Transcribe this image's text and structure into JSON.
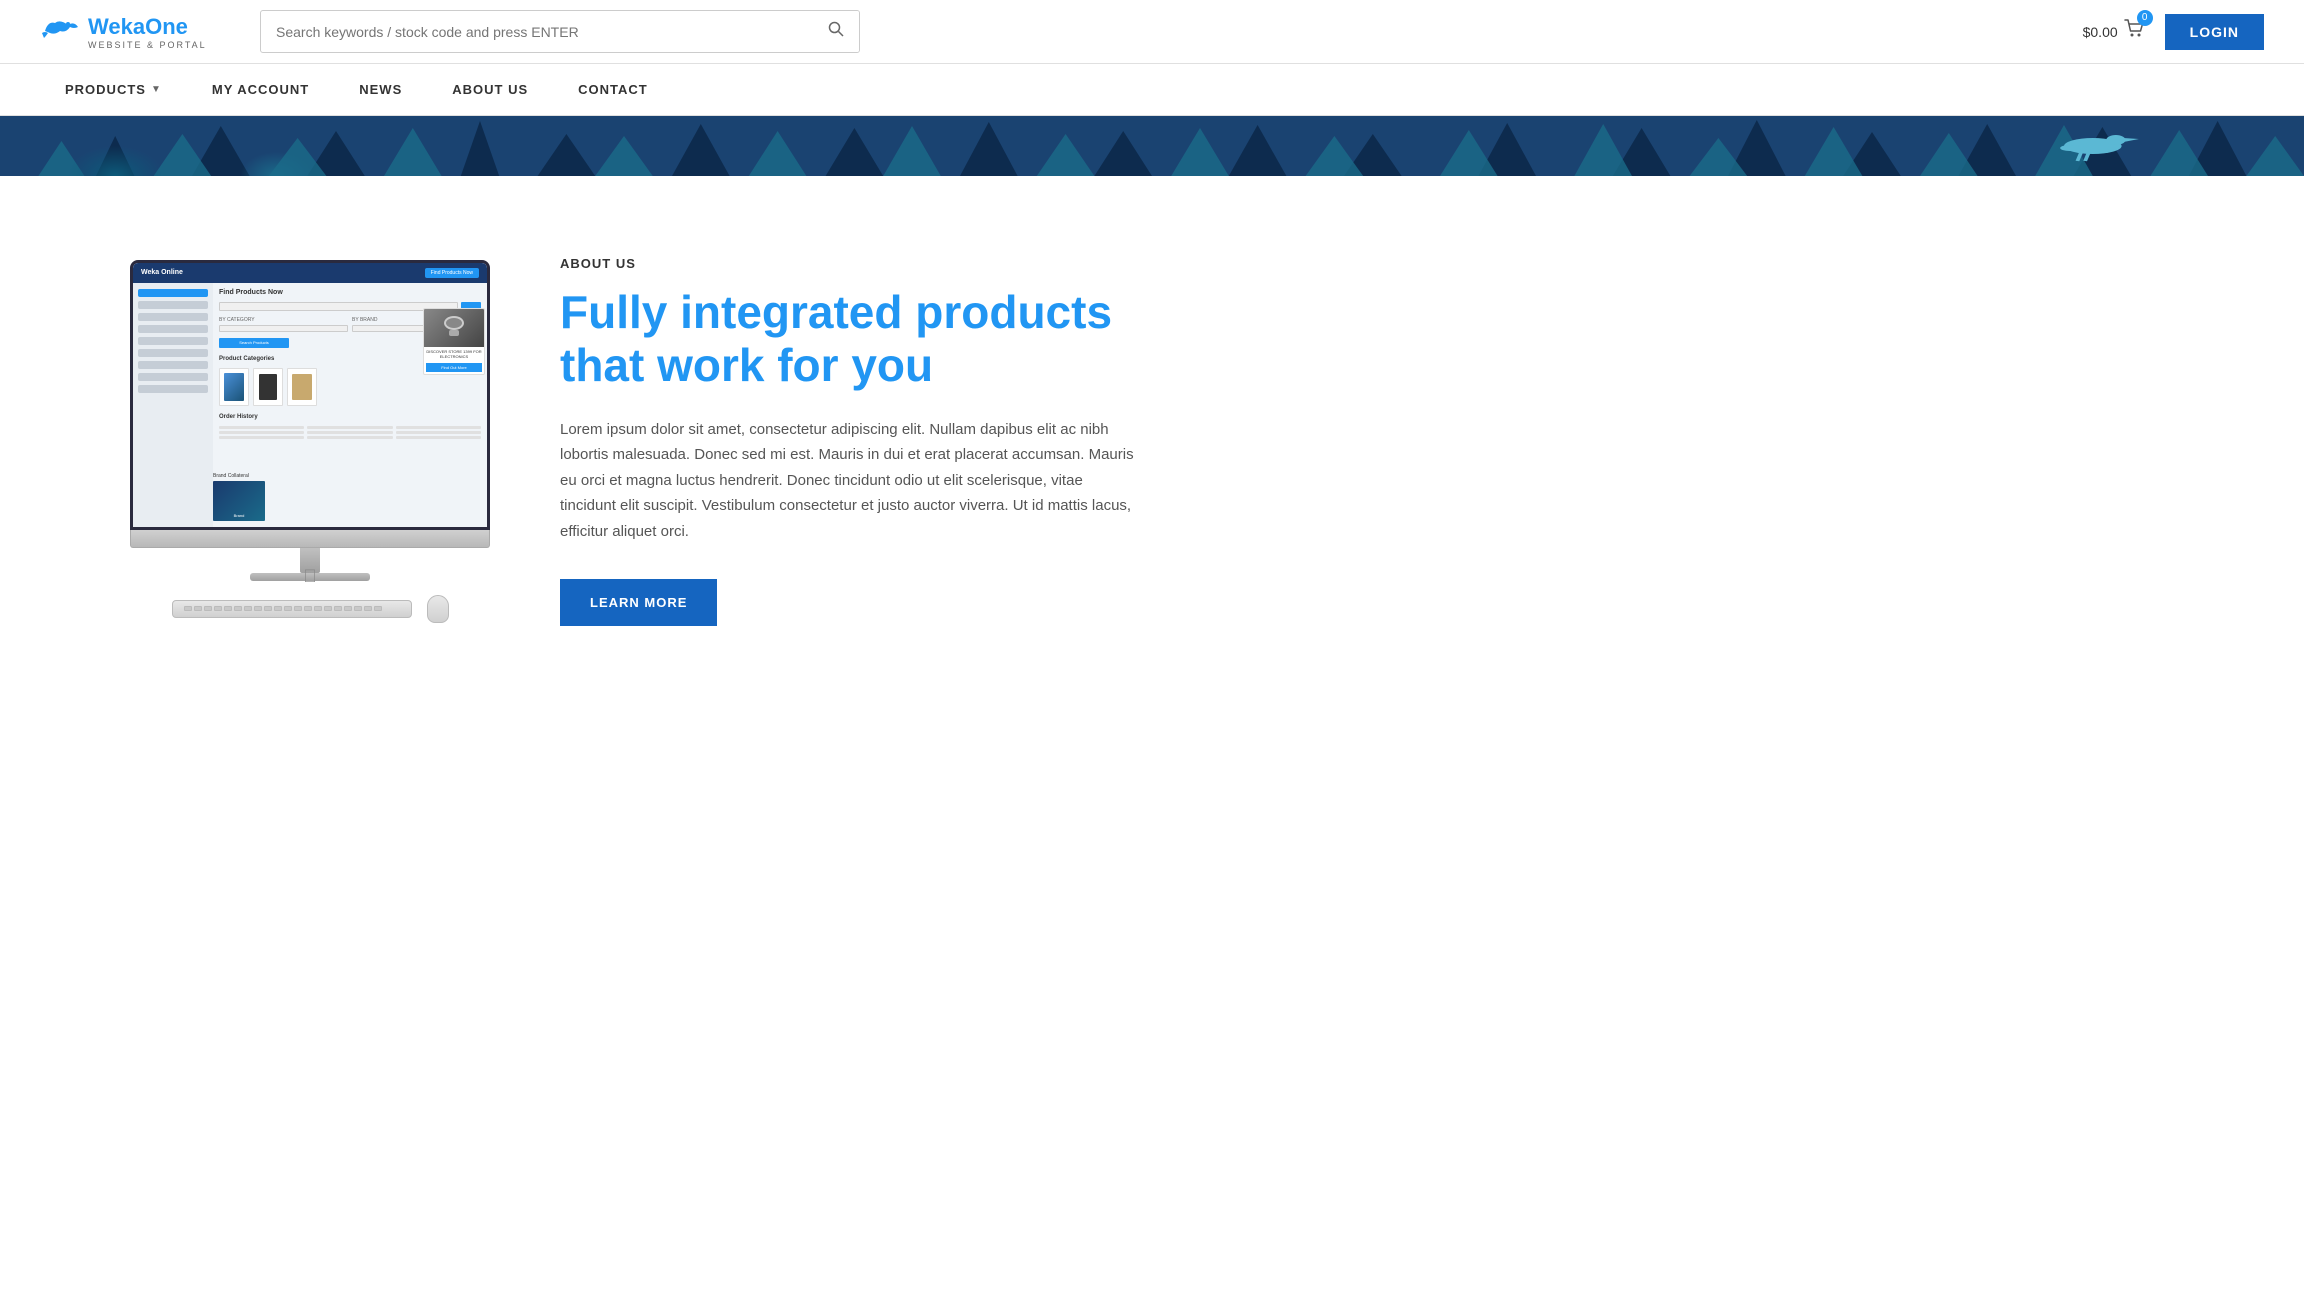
{
  "header": {
    "logo": {
      "brand": "Weka One",
      "tagline": "WEBSITE & PORTAL",
      "brand_prefix": "Weka",
      "brand_suffix": "One"
    },
    "search": {
      "placeholder": "Search keywords / stock code and press ENTER"
    },
    "cart": {
      "price": "$0.00",
      "badge": "0"
    },
    "login_label": "LOGIN"
  },
  "nav": {
    "items": [
      {
        "label": "PRODUCTS",
        "has_dropdown": true
      },
      {
        "label": "MY ACCOUNT",
        "has_dropdown": false
      },
      {
        "label": "NEWS",
        "has_dropdown": false
      },
      {
        "label": "ABOUT US",
        "has_dropdown": false
      },
      {
        "label": "CONTACT",
        "has_dropdown": false
      }
    ]
  },
  "main": {
    "section_label": "ABOUT US",
    "heading_line1": "Fully integrated products",
    "heading_line2": "that work for you",
    "body_text": "Lorem ipsum dolor sit amet, consectetur adipiscing elit. Nullam dapibus elit ac nibh lobortis malesuada. Donec sed mi est. Mauris in dui et erat placerat accumsan. Mauris eu orci et magna luctus hendrerit. Donec tincidunt odio ut elit scelerisque, vitae tincidunt elit suscipit. Vestibulum consectetur et justo auctor viverra. Ut id mattis lacus, efficitur aliquet orci.",
    "learn_more_label": "LEARN MORE"
  },
  "monitor": {
    "screen": {
      "topbar_logo": "Weka Online",
      "featured_text": "DISCOVER STORE 1399 FOR ELECTRONICS",
      "featured_btn": "Find Out More",
      "section_title": "Find Products Now",
      "products_title": "Product Categories",
      "orders_title": "Order History",
      "brand_title": "Brand Collateral"
    }
  },
  "colors": {
    "accent_blue": "#2196f3",
    "dark_blue": "#1565c0",
    "nav_text": "#333333",
    "heading_blue": "#2196f3",
    "hero_bg": "#1a5276"
  }
}
